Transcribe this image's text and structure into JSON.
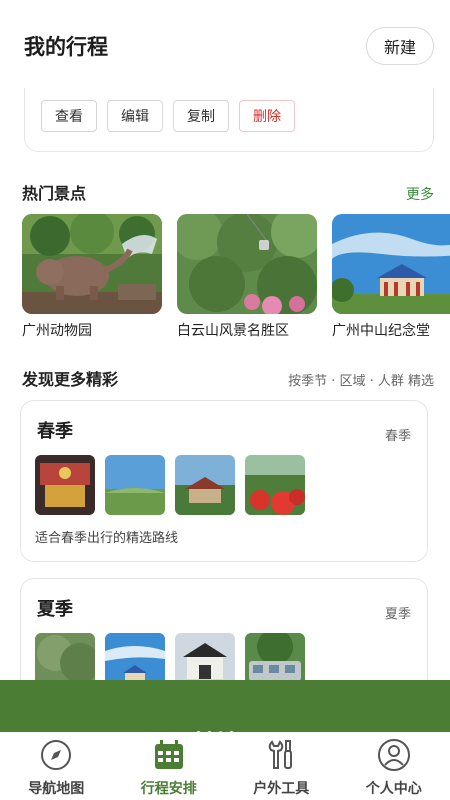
{
  "header": {
    "title": "我的行程",
    "new_label": "新建"
  },
  "trip_card": {
    "actions": [
      "查看",
      "编辑",
      "复制",
      "删除"
    ]
  },
  "hot_spots": {
    "title": "热门景点",
    "more_label": "更多",
    "items": [
      {
        "name": "广州动物园"
      },
      {
        "name": "白云山风景名胜区"
      },
      {
        "name": "广州中山纪念堂"
      }
    ]
  },
  "discover": {
    "title": "发现更多精彩",
    "filters": "按季节 · 区域 · 人群 精选",
    "cards": [
      {
        "title": "春季",
        "tag": "春季",
        "desc": "适合春季出行的精选路线"
      },
      {
        "title": "夏季",
        "tag": "夏季",
        "desc": ""
      }
    ]
  },
  "colors": {
    "accent": "#4b7d34",
    "link": "#3c8a3c",
    "danger": "#d9302c"
  },
  "tabbar": {
    "items": [
      {
        "label": "导航地图",
        "icon": "compass-icon",
        "active": false
      },
      {
        "label": "行程安排",
        "icon": "calendar-icon",
        "active": true
      },
      {
        "label": "户外工具",
        "icon": "tools-icon",
        "active": false
      },
      {
        "label": "个人中心",
        "icon": "user-icon",
        "active": false
      }
    ]
  }
}
